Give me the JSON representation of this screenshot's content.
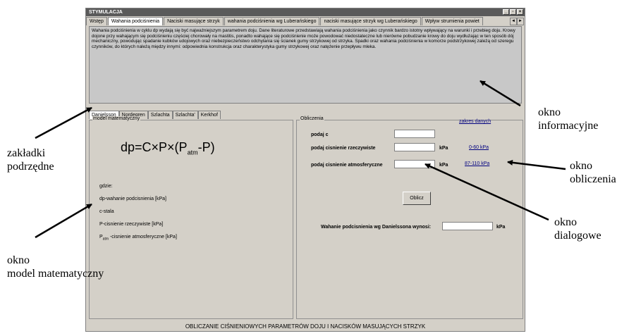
{
  "window": {
    "title": "STYMULACJA",
    "controls": [
      "_",
      "▫",
      "×"
    ]
  },
  "tabs": [
    "Wstęp",
    "Wahania podciśnienia",
    "Naciski masujące strzyk",
    "wahania podciśnienia wg Luberańskiego",
    "naciski masujące strzyk wg Luberańskiego",
    "Wpływ strumienia powiet"
  ],
  "tab_arrows": [
    "◄",
    "►"
  ],
  "info_text": "Wahania podciśnienia w cyklu dp wydają się być najważniejszym parametrem doju. Dane literaturowe przedstawiają wahania podciśnienia jako czynnik bardzo istotny wpływający na warunki i przebieg doju. Krowy dojone przy wahającym się podciśnieniu częściej chorowały na mastitis, ponadto wahające się podciśnienie może powodować niedostateczne lub nierówne pobudzanie krowy do doju wydłużając w ten sposób dój mechaniczny, powodując spadanie kubków udojowych oraz niebezpieczeństwo odchylania się ścianek gumy strzykowej od strzyka. Spadki oraz wahania podciśnienia w komorze podstrzykowej zależą od szeregu czynników, do których należą między innymi: odpowiednia konstrukcja oraz charakterystyka gumy strzykowej oraz natężenie przepływu mleka.",
  "subtabs": [
    "Danielsson",
    "Nordegren",
    "Szlachta",
    "Szlachta'",
    "Kerkhof"
  ],
  "model": {
    "legend": "model matematyczny",
    "formula_main": "dp=C×P×(P",
    "formula_sub": "atm",
    "formula_end": "-P)",
    "gdzie": "gdzie:",
    "line1": "dp-wahanie podcisnienia [kPa]",
    "line2": "c-stala",
    "line3": "P-cisnienie rzeczywiste [kPa]",
    "line4_pre": "P",
    "line4_sub": "atm",
    "line4_post": " -cisnienie atmosferyczne [kPa]"
  },
  "calc": {
    "legend": "Obliczenia",
    "range_header": "zakres danych",
    "label_c": "podaj c",
    "label_real": "podaj cisnienie rzeczywiste",
    "label_atm": "podaj cisnienie atmosferyczne",
    "unit": "kPa",
    "range_real": "0-60 kPa",
    "range_atm": "87-110 kPa",
    "button": "Oblicz",
    "result_label": "Wahanie podcisnienia wg Danielssona wynosi:",
    "result_unit": "kPa"
  },
  "footer": "OBLICZANIE CIŚNIENIOWYCH PARAMETRÓW DOJU I NACISKÓW MASUJĄCYCH STRZYK",
  "annotations": {
    "info_l1": "okno",
    "info_l2": "informacyjne",
    "calc_l1": "okno",
    "calc_l2": "obliczenia",
    "dialog_l1": "okno",
    "dialog_l2": "dialogowe",
    "subtabs_l1": "zakładki",
    "subtabs_l2": "podrzędne",
    "model_l1": "okno",
    "model_l2": "model matematyczny"
  }
}
